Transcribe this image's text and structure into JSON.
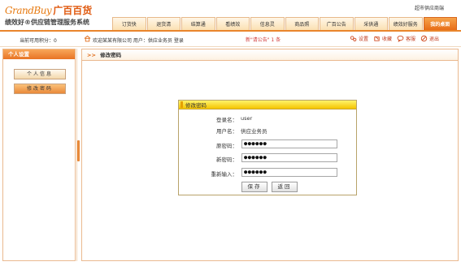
{
  "brand": {
    "logo_latin": "GrandBuy",
    "logo_cn": "广百百货",
    "slogan": "绩效好®供应链管理服务系统",
    "site": "超市供应商端"
  },
  "nav": {
    "tabs": [
      {
        "label": "订货快",
        "active": false
      },
      {
        "label": "退货清",
        "active": false
      },
      {
        "label": "结算通",
        "active": false
      },
      {
        "label": "看绩效",
        "active": false
      },
      {
        "label": "信息灵",
        "active": false
      },
      {
        "label": "商品照",
        "active": false
      },
      {
        "label": "广百公告",
        "active": false
      },
      {
        "label": "采供通",
        "active": false
      },
      {
        "label": "绩效好服务",
        "active": false
      },
      {
        "label": "我的桌面",
        "active": true
      }
    ]
  },
  "infobar": {
    "points": "当前可用积分：0",
    "welcome": "欢迎某某有限公司 用户：供应业务员 登录",
    "notice": "新\"请公告\" 1 条",
    "tools": [
      {
        "label": "设置",
        "icon": "settings-icon"
      },
      {
        "label": "收藏",
        "icon": "favorite-icon"
      },
      {
        "label": "客服",
        "icon": "service-icon"
      },
      {
        "label": "退出",
        "icon": "logout-icon"
      }
    ]
  },
  "left": {
    "title": "个人设置",
    "buttons": [
      "个人信息",
      "修改密码"
    ]
  },
  "main": {
    "breadcrumb": "修改密码"
  },
  "dialog": {
    "title": "修改密码",
    "login_label": "登录名：",
    "login_value": "user",
    "user_label": "用户名：",
    "user_value": "供应业务员",
    "old_label": "原密码：",
    "old_value": "●●●●●●",
    "new_label": "新密码：",
    "new_value": "●●●●●●",
    "confirm_label": "重新输入：",
    "confirm_value": "●●●●●●",
    "save_label": "保存",
    "back_label": "返回"
  },
  "colors": {
    "accent": "#e9852c",
    "dialog_title": "#f5c400"
  }
}
